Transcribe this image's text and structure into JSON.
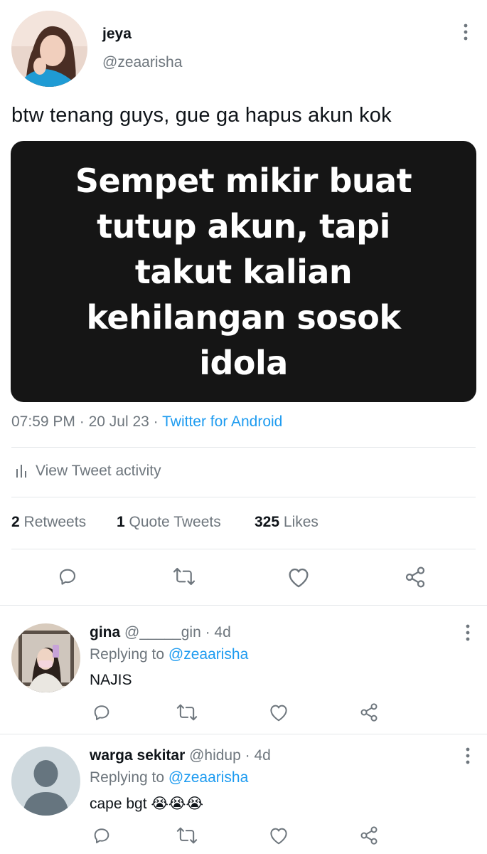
{
  "tweet": {
    "author_name": "jeya",
    "author_handle": "@zeaarisha",
    "text": "btw tenang guys, gue ga hapus akun kok",
    "image_text": "Sempet mikir buat tutup akun, tapi takut kalian kehilangan sosok idola",
    "time": "07:59 PM",
    "date": "20 Jul 23",
    "separator": "·",
    "client": "Twitter for Android",
    "activity_label": "View Tweet activity",
    "stats": {
      "retweets_count": "2",
      "retweets_label": "Retweets",
      "quotes_count": "1",
      "quotes_label": "Quote Tweets",
      "likes_count": "325",
      "likes_label": "Likes"
    }
  },
  "replies": [
    {
      "name": "gina",
      "handle": "@_____gin",
      "age": "· 4d",
      "replying_prefix": "Replying to",
      "replying_to": "@zeaarisha",
      "text": "NAJIS"
    },
    {
      "name": "warga sekitar",
      "handle": "@hidup",
      "age": "· 4d",
      "replying_prefix": "Replying to",
      "replying_to": "@zeaarisha",
      "text": "cape bgt 😭😭😭"
    }
  ],
  "icons": [
    "more-vertical-icon",
    "bar-chart-icon",
    "reply-icon",
    "retweet-icon",
    "like-icon",
    "share-icon",
    "default-avatar-icon"
  ],
  "colors": {
    "link": "#1d9bf0",
    "secondary_text": "#6e767d",
    "divider": "#e4e7ea",
    "image_bg": "#151515"
  }
}
